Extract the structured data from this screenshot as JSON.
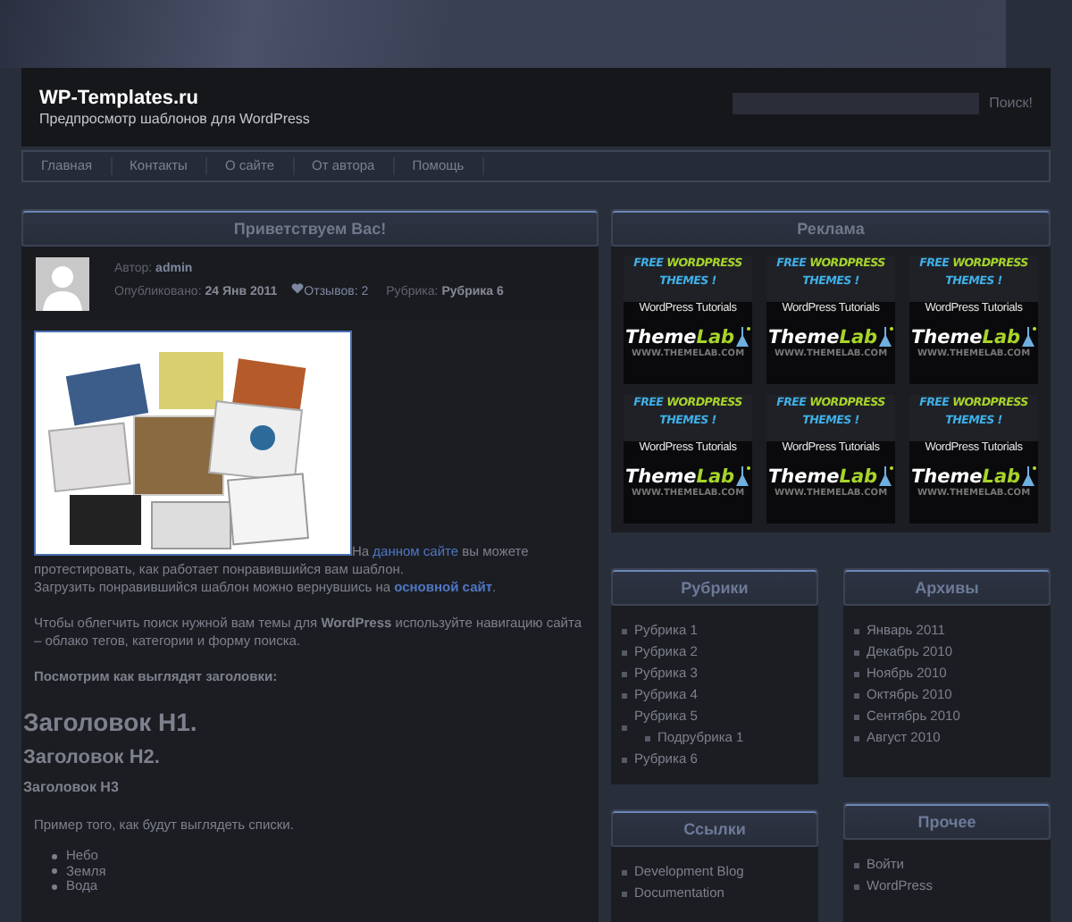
{
  "header": {
    "site_title": "WP-Templates.ru",
    "tagline": "Предпросмотр шаблонов для WordPress",
    "search": {
      "button": "Поиск!"
    }
  },
  "nav": [
    "Главная",
    "Контакты",
    "О сайте",
    "От автора",
    "Помощь"
  ],
  "post": {
    "title": "Приветствуем Вас!",
    "author_label": "Автор:",
    "author": "admin",
    "published_label": "Опубликовано:",
    "date": "24 Янв 2011",
    "comments": "Отзывов: 2",
    "category_label": "Рубрика:",
    "category": "Рубрика 6",
    "paragraphs": [
      {
        "before": "На ",
        "link": "данном сайте",
        "after": " вы можете протестировать, как работает понравившийся вам шаблон."
      },
      {
        "before": "Загрузить понравившийся шаблон можно вернувшись на ",
        "link": "основной сайт",
        "after": "."
      }
    ],
    "nav_note": "Чтобы облегчить поиск нужной вам темы для **WordPress** используйте навигацию сайта – облако тегов, категории и форму поиска.",
    "headings_intro": "Посмотрим как выглядят заголовки:",
    "h1": "Заголовок H1.",
    "h2": "Заголовок H2.",
    "h3": "Заголовок H3",
    "list_intro": "Пример того, как будут выглядеть списки.",
    "list": [
      "Небо",
      "Земля",
      "Вода"
    ]
  },
  "ads": {
    "title": "Реклама",
    "items": [
      {
        "free": "FREE",
        "wordpress": "WORDPRESS",
        "themes": "THEMES !",
        "tutorials": "WordPress Tutorials",
        "brand_a": "Theme",
        "brand_b": "Lab",
        "url": "WWW.THEMELAB.COM"
      },
      {
        "free": "FREE",
        "wordpress": "WORDPRESS",
        "themes": "THEMES !",
        "tutorials": "WordPress Tutorials",
        "brand_a": "Theme",
        "brand_b": "Lab",
        "url": "WWW.THEMELAB.COM"
      },
      {
        "free": "FREE",
        "wordpress": "WORDPRESS",
        "themes": "THEMES !",
        "tutorials": "WordPress Tutorials",
        "brand_a": "Theme",
        "brand_b": "Lab",
        "url": "WWW.THEMELAB.COM"
      },
      {
        "free": "FREE",
        "wordpress": "WORDPRESS",
        "themes": "THEMES !",
        "tutorials": "WordPress Tutorials",
        "brand_a": "Theme",
        "brand_b": "Lab",
        "url": "WWW.THEMELAB.COM"
      },
      {
        "free": "FREE",
        "wordpress": "WORDPRESS",
        "themes": "THEMES !",
        "tutorials": "WordPress Tutorials",
        "brand_a": "Theme",
        "brand_b": "Lab",
        "url": "WWW.THEMELAB.COM"
      },
      {
        "free": "FREE",
        "wordpress": "WORDPRESS",
        "themes": "THEMES !",
        "tutorials": "WordPress Tutorials",
        "brand_a": "Theme",
        "brand_b": "Lab",
        "url": "WWW.THEMELAB.COM"
      }
    ]
  },
  "widgets_left": [
    {
      "title": "Рубрики",
      "items": [
        {
          "label": "Рубрика 1"
        },
        {
          "label": "Рубрика 2"
        },
        {
          "label": "Рубрика 3"
        },
        {
          "label": "Рубрика 4"
        },
        {
          "label": "Рубрика 5",
          "children": [
            {
              "label": "Подрубрика 1"
            }
          ]
        },
        {
          "label": "Рубрика 6"
        }
      ]
    },
    {
      "title": "Ссылки",
      "items": [
        {
          "label": "Development Blog"
        },
        {
          "label": "Documentation"
        }
      ]
    }
  ],
  "widgets_right": [
    {
      "title": "Архивы",
      "items": [
        {
          "label": "Январь 2011"
        },
        {
          "label": "Декабрь 2010"
        },
        {
          "label": "Ноябрь 2010"
        },
        {
          "label": "Октябрь 2010"
        },
        {
          "label": "Сентябрь 2010"
        },
        {
          "label": "Август 2010"
        }
      ]
    },
    {
      "title": "Прочее",
      "items": [
        {
          "label": "Войти"
        },
        {
          "label": "WordPress"
        }
      ]
    }
  ]
}
